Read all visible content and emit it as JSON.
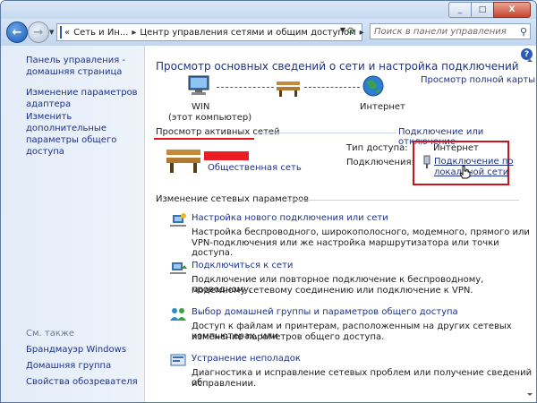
{
  "window": {
    "minimize": "_",
    "maximize": "□",
    "close": "X"
  },
  "nav": {
    "breadcrumb_1": "Сеть и Ин...",
    "breadcrumb_2": "Центр управления сетями и общим доступом",
    "search_placeholder": "Поиск в панели управления"
  },
  "sidebar": {
    "items": [
      "Панель управления - домашняя страница",
      "Изменение параметров адаптера",
      "Изменить дополнительные параметры общего доступа"
    ],
    "see_also_title": "См. также",
    "see_also": [
      "Брандмауэр Windows",
      "Домашняя группа",
      "Свойства обозревателя"
    ]
  },
  "main": {
    "title": "Просмотр основных сведений о сети и настройка подключений",
    "full_map_link": "Просмотр полной карты",
    "computer_name": "WIN",
    "computer_sub": "(этот компьютер)",
    "internet_label": "Интернет",
    "active_networks_title": "Просмотр активных сетей",
    "connect_disconnect_link": "Подключение или отключение",
    "network_type": "Общественная сеть",
    "access_type_label": "Тип доступа:",
    "access_type_value": "Интернет",
    "connections_label": "Подключения:",
    "connection_link_1": "Подключение по",
    "connection_link_2": "локальной сети",
    "change_settings_title": "Изменение сетевых параметров",
    "tasks": [
      {
        "title": "Настройка нового подключения или сети",
        "desc_1": "Настройка беспроводного, широкополосного, модемного, прямого или",
        "desc_2": "VPN-подключения или же настройка маршрутизатора или точки доступа."
      },
      {
        "title": "Подключиться к сети",
        "desc_1": "Подключение или повторное подключение к беспроводному, проводному,",
        "desc_2": "модемному сетевому соединению или подключение к VPN."
      },
      {
        "title": "Выбор домашней группы и параметров общего доступа",
        "desc_1": "Доступ к файлам и принтерам, расположенным на других сетевых компьютерах, или",
        "desc_2": "изменение параметров общего доступа."
      },
      {
        "title": "Устранение неполадок",
        "desc_1": "Диагностика и исправление сетевых проблем или получение сведений об",
        "desc_2": "исправлении."
      }
    ]
  },
  "help": "?"
}
